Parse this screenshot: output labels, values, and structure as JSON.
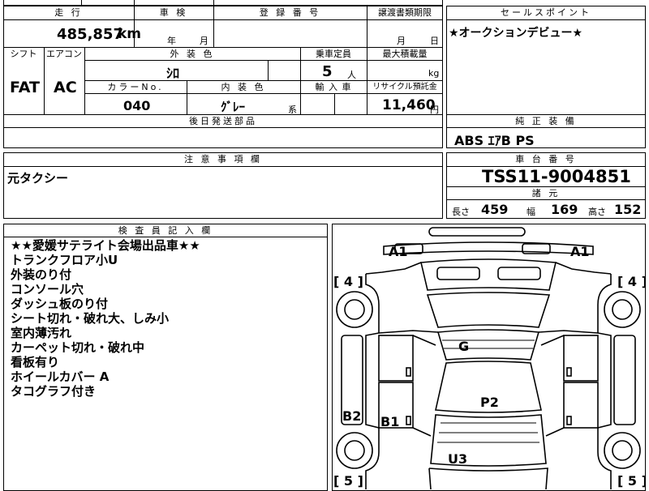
{
  "headers": {
    "mileage": "走 行",
    "shaken": "車 検",
    "registration": "登 録 番 号",
    "transfer_deadline": "譲渡書類期限",
    "sales_point": "セールスポイント",
    "shift": "シフト",
    "aircon": "エアコン",
    "exterior_color": "外 装 色",
    "capacity": "乗車定員",
    "max_load": "最大積載量",
    "color_no": "カラーNo.",
    "interior_color": "内 装 色",
    "import": "輸 入 車",
    "recycle": "リサイクル預託金",
    "followup_parts": "後日発送部品",
    "genuine_equipment": "純 正 装 備",
    "notes": "注 意 事 項 欄",
    "chassis": "車 台 番 号",
    "specs": "諸 元",
    "inspector": "検 査 員 記 入 欄"
  },
  "vehicle": {
    "mileage": "485,857",
    "mileage_unit": "km",
    "shaken_year_unit": "年",
    "shaken_month_unit": "月",
    "transfer_month_unit": "月",
    "transfer_day_unit": "日",
    "shift": "FAT",
    "aircon": "AC",
    "exterior_color": "ｼﾛ",
    "capacity": "5",
    "capacity_unit": "人",
    "max_load_unit": "kg",
    "color_no": "040",
    "interior_color": "ｸﾞﾚｰ",
    "interior_suffix": "系",
    "recycle": "11,460",
    "recycle_unit": "円",
    "sales_point": "★オークションデビュー★",
    "equipment": "ABS ｴｱB PS",
    "notes": "元タクシー",
    "chassis": "TSS11-9004851",
    "length_label": "長さ",
    "length": "459",
    "width_label": "幅",
    "width": "169",
    "height_label": "高さ",
    "height": "152"
  },
  "inspector_remarks": [
    "★★愛媛サテライト会場出品車★★",
    "トランクフロア小U",
    "外装のり付",
    "コンソール穴",
    "ダッシュ板のり付",
    "シート切れ・破れ大、しみ小",
    "室内薄汚れ",
    "カーペット切れ・破れ中",
    "看板有り",
    "ホイールカバー A",
    "タコグラフ付き"
  ],
  "damage_map": {
    "A1_left": "A1",
    "A1_right": "A1",
    "four_left": "[ 4 ]",
    "four_right": "[ 4 ]",
    "five_left": "[ 5 ]",
    "five_right": "[ 5 ]",
    "G": "G",
    "P2": "P2",
    "B2": "B2",
    "B1": "B1",
    "U3": "U3"
  }
}
